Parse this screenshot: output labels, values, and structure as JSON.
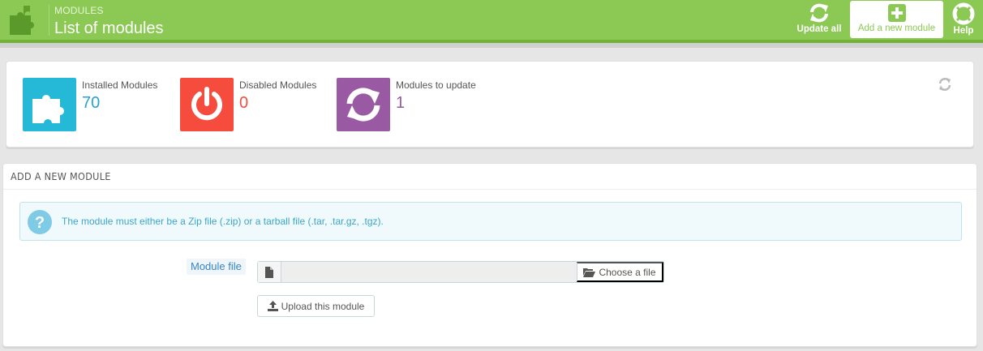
{
  "header": {
    "breadcrumb": "MODULES",
    "title": "List of modules",
    "toolbar": {
      "update_all": "Update all",
      "add_new": "Add a new module",
      "help": "Help"
    },
    "colors": {
      "bar": "#8bc954",
      "accent": "#72b236"
    }
  },
  "kpis": [
    {
      "label": "Installed Modules",
      "value": "70",
      "icon": "puzzle-icon",
      "color": "#25b9d7",
      "value_color": "#25a3d8"
    },
    {
      "label": "Disabled Modules",
      "value": "0",
      "icon": "power-icon",
      "color": "#f54c3e",
      "value_color": "#f54c3e"
    },
    {
      "label": "Modules to update",
      "value": "1",
      "icon": "refresh-icon",
      "color": "#9a5aa3",
      "value_color": "#9a5aa3"
    }
  ],
  "add_module": {
    "heading": "ADD A NEW MODULE",
    "info": "The module must either be a Zip file (.zip) or a tarball file (.tar, .tar.gz, .tgz).",
    "field_label": "Module file",
    "file_value": "",
    "choose_label": "Choose a file",
    "upload_label": "Upload this module"
  }
}
